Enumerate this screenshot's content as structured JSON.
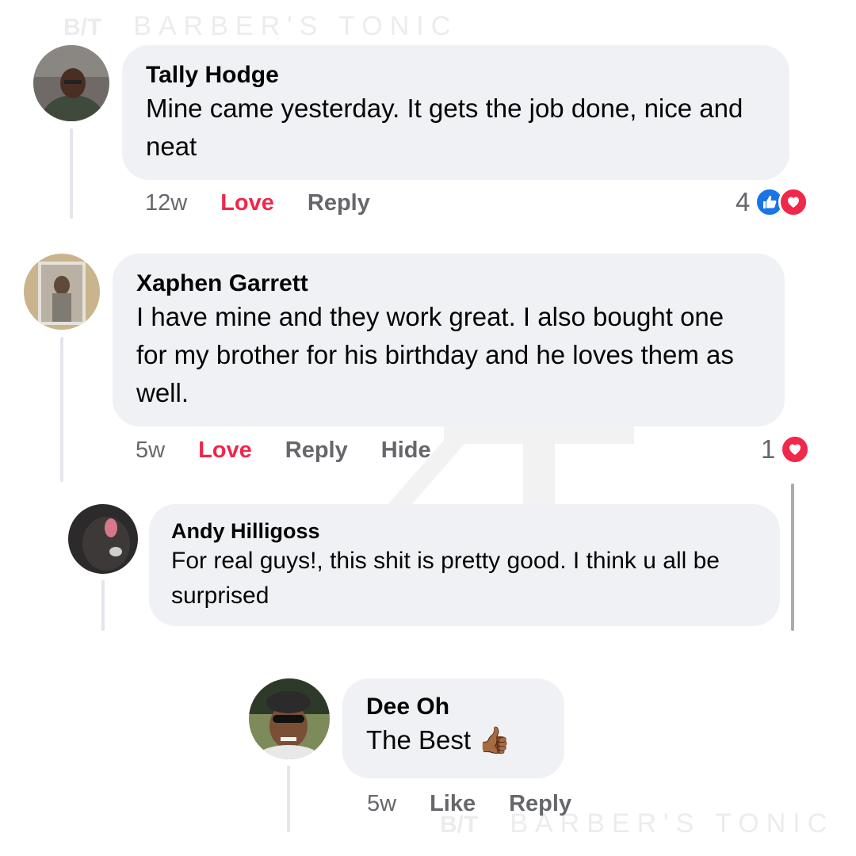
{
  "watermark": {
    "monogram": "B/T",
    "brand": "BARBER'S TONIC"
  },
  "comments": [
    {
      "author": "Tally Hodge",
      "text": "Mine came yesterday. It gets the job done, nice and neat",
      "time": "12w",
      "actions": [
        "Love",
        "Reply"
      ],
      "reaction_count": "4",
      "reactions": [
        "like",
        "love"
      ]
    },
    {
      "author": "Xaphen Garrett",
      "text": "I have mine and they work great. I also bought one for my brother for his birthday and he loves them as well.",
      "time": "5w",
      "actions": [
        "Love",
        "Reply",
        "Hide"
      ],
      "reaction_count": "1",
      "reactions": [
        "love"
      ]
    },
    {
      "author": "Andy Hilligoss",
      "text": "For real guys!, this shit is pretty good. I think u all be surprised"
    },
    {
      "author": "Dee Oh",
      "text": "The Best",
      "emoji": "👍🏾",
      "time": "5w",
      "actions": [
        "Like",
        "Reply"
      ]
    }
  ],
  "colors": {
    "love": "#f02849",
    "like": "#1b74e4",
    "bubble": "#f0f1f4",
    "muted": "#65676b"
  }
}
